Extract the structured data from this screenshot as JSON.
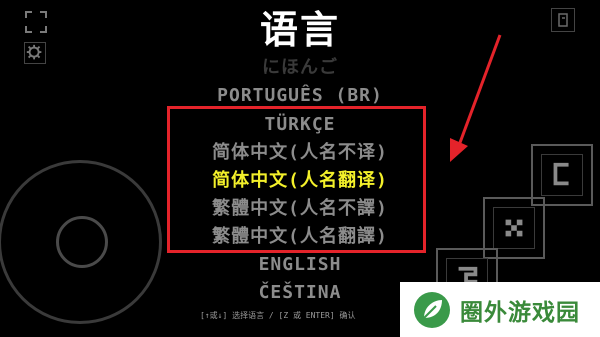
{
  "screen": {
    "title": "语言"
  },
  "languages": {
    "items": [
      {
        "label": "にほんご",
        "state": "dim"
      },
      {
        "label": "PORTUGUÊS (BR)",
        "state": "normal"
      },
      {
        "label": "TÜRKÇE",
        "state": "normal"
      },
      {
        "label": "简体中文(人名不译)",
        "state": "normal"
      },
      {
        "label": "简体中文(人名翻译)",
        "state": "selected"
      },
      {
        "label": "繁體中文(人名不譯)",
        "state": "normal"
      },
      {
        "label": "繁體中文(人名翻譯)",
        "state": "normal"
      },
      {
        "label": "ENGLISH",
        "state": "normal"
      },
      {
        "label": "ČEŠTINA",
        "state": "normal"
      }
    ]
  },
  "hint": {
    "text": "[↑或↓] 选择语言 / [Z 或 ENTER] 确认"
  },
  "controls": {
    "top_right_label": "▯",
    "button_c": "C",
    "button_x": "X",
    "button_z": "Z"
  },
  "watermark": {
    "text": "圈外游戏园"
  },
  "colors": {
    "background": "#000000",
    "title": "#ffffff",
    "menu_text": "#8c8c8c",
    "menu_dim": "#3a3a3a",
    "selected": "#f3f02a",
    "highlight_box": "#e4232a",
    "annotation_arrow": "#e4232a",
    "watermark_green": "#3a8a3a"
  },
  "icons": {
    "fullscreen": "fullscreen-icon",
    "settings": "gear-icon",
    "top_right": "menu-icon",
    "joystick": "joystick-icon",
    "annotation": "arrow-icon",
    "watermark_logo": "leaf-logo-icon"
  }
}
